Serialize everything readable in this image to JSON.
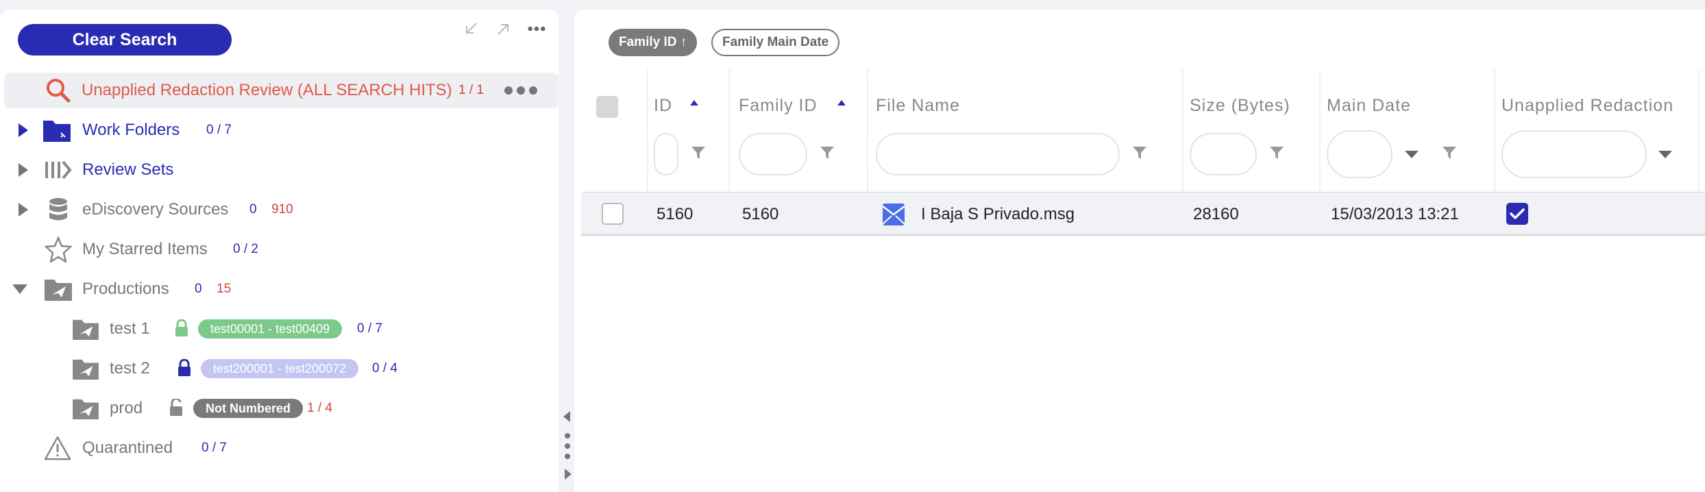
{
  "left_panel": {
    "clear_search_label": "Clear Search",
    "tree": [
      {
        "label": "Unapplied Redaction Review (ALL SEARCH HITS)",
        "count_a": "1 / 1",
        "icon": "search-icon"
      },
      {
        "label": "Work Folders",
        "count_a": "0 / 7",
        "icon": "folder-icon"
      },
      {
        "label": "Review Sets",
        "icon": "review-sets-icon"
      },
      {
        "label": "eDiscovery Sources",
        "count_a": "0",
        "count_b": "910",
        "icon": "database-icon"
      },
      {
        "label": "My Starred Items",
        "count_a": "0 / 2",
        "icon": "star-icon"
      },
      {
        "label": "Productions",
        "count_a": "0",
        "count_b": "15",
        "icon": "production-folder-icon"
      },
      {
        "label": "test 1",
        "pill": "test00001 - test00409",
        "count_a": "0 / 7",
        "lock": "locked-green"
      },
      {
        "label": "test 2",
        "pill": "test200001 - test200072",
        "count_a": "0 / 4",
        "lock": "locked-navy"
      },
      {
        "label": "prod",
        "pill": "Not Numbered",
        "count_a": "1 / 4",
        "lock": "unlocked-gray"
      },
      {
        "label": "Quarantined",
        "count_a": "0 / 7",
        "icon": "warning-icon"
      }
    ]
  },
  "colors": {
    "brand": "#2a2bb3",
    "alert": "#e05a4a",
    "pill_green": "#7cc98a",
    "pill_lavender": "#c3c6f2",
    "pill_gray": "#7a7a7a"
  },
  "sort_chips": [
    {
      "label": "Family ID ↑",
      "active": true
    },
    {
      "label": "Family Main Date",
      "active": false
    }
  ],
  "table": {
    "columns": [
      "ID",
      "Family ID",
      "File Name",
      "Size (Bytes)",
      "Main Date",
      "Unapplied Redaction"
    ],
    "rows": [
      {
        "id": "5160",
        "family_id": "5160",
        "file_name": "I Baja S Privado.msg",
        "file_icon": "email-icon",
        "size": "28160",
        "main_date": "15/03/2013 13:21",
        "unapplied_redaction": true
      }
    ]
  }
}
